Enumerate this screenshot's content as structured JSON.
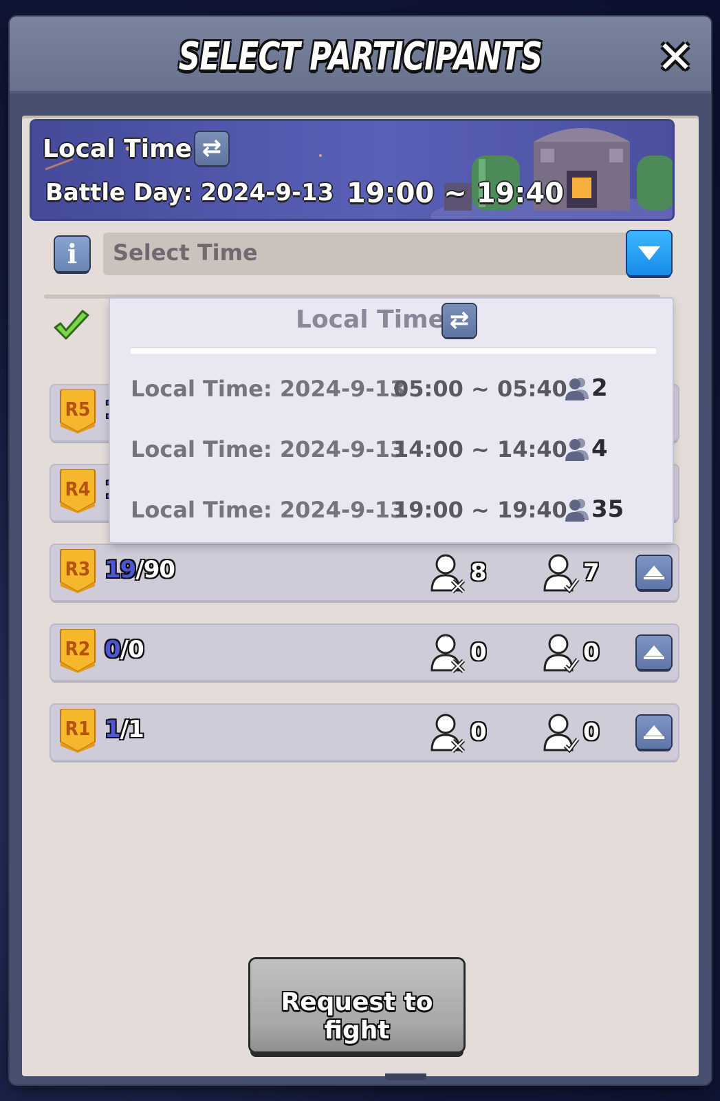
{
  "header": {
    "title": "SELECT PARTICIPANTS",
    "close_icon": "close-icon"
  },
  "banner": {
    "label": "Local Time",
    "battle_day": "Battle Day: 2024-9-13",
    "time_range": "19:00 ~ 19:40"
  },
  "select": {
    "placeholder": "Select Time"
  },
  "popup": {
    "title": "Local Time",
    "options": [
      {
        "date": "Local Time: 2024-9-13",
        "range": "05:00 ~ 05:40",
        "count": "2"
      },
      {
        "date": "Local Time: 2024-9-13",
        "range": "14:00 ~ 14:40",
        "count": "4"
      },
      {
        "date": "Local Time: 2024-9-13",
        "range": "19:00 ~ 19:40",
        "count": "35"
      }
    ]
  },
  "ranks": [
    {
      "badge": "R5",
      "selected": "1",
      "total": "",
      "absent": "",
      "joined": ""
    },
    {
      "badge": "R4",
      "selected": "1",
      "total": "",
      "absent": "",
      "joined": ""
    },
    {
      "badge": "R3",
      "selected": "19",
      "total": "/90",
      "absent": "8",
      "joined": "7"
    },
    {
      "badge": "R2",
      "selected": "0",
      "total": "/0",
      "absent": "0",
      "joined": "0"
    },
    {
      "badge": "R1",
      "selected": "1",
      "total": "/1",
      "absent": "0",
      "joined": "0"
    }
  ],
  "footer": {
    "fight_label": "Request to fight"
  },
  "colors": {
    "accent_blue": "#178be8",
    "panel_bg": "#e4dcd8",
    "row_bg": "#cfcbd9",
    "badge_gold": "#f6b72c",
    "selected_count": "#4d57d6"
  }
}
